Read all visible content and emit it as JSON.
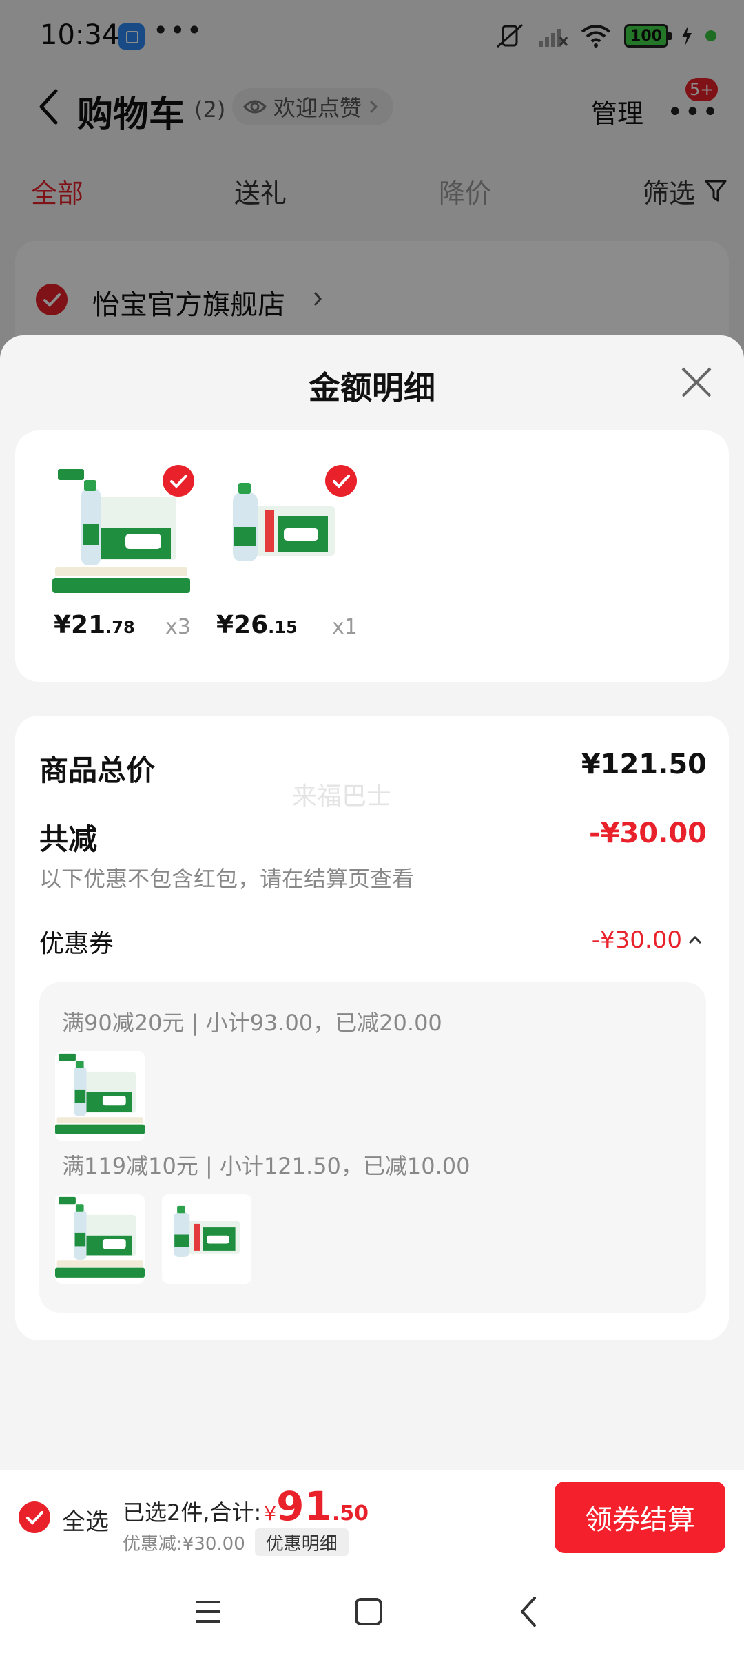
{
  "status_bar": {
    "time": "10:34",
    "dots": "•••",
    "battery": "100"
  },
  "header": {
    "title": "购物车",
    "count": "(2)",
    "like_pill": "欢迎点赞",
    "manage": "管理",
    "more": "•••",
    "badge": "5+"
  },
  "tabs": [
    {
      "label": "全部"
    },
    {
      "label": "送礼"
    },
    {
      "label": "降价"
    },
    {
      "label": "筛选"
    }
  ],
  "store": {
    "name": "怡宝官方旗舰店"
  },
  "sheet": {
    "title": "金额明细",
    "products": [
      {
        "price_int": "¥21",
        "price_dec": ".78",
        "qty": "x3"
      },
      {
        "price_int": "¥26",
        "price_dec": ".15",
        "qty": "x1"
      }
    ],
    "total_label": "商品总价",
    "total_value": "¥121.50",
    "watermark": "来福巴士",
    "reduce_label": "共减",
    "reduce_value": "-¥30.00",
    "reduce_note": "以下优惠不包含红包，请在结算页查看",
    "coupon_label": "优惠券",
    "coupon_value": "-¥30.00",
    "rules": [
      {
        "text": "满90减20元 | 小计93.00，已减20.00"
      },
      {
        "text": "满119减10元 | 小计121.50，已减10.00"
      }
    ]
  },
  "bottom_bar": {
    "select_all": "全选",
    "summary_prefix": "已选2件,合计:",
    "currency": "¥",
    "total_int": "91",
    "total_dec": ".50",
    "discount_text": "优惠减:¥30.00",
    "discount_detail_btn": "优惠明细",
    "checkout": "领券结算"
  },
  "colors": {
    "accent": "#e8212a",
    "brand_green": "#1f8f3f"
  }
}
